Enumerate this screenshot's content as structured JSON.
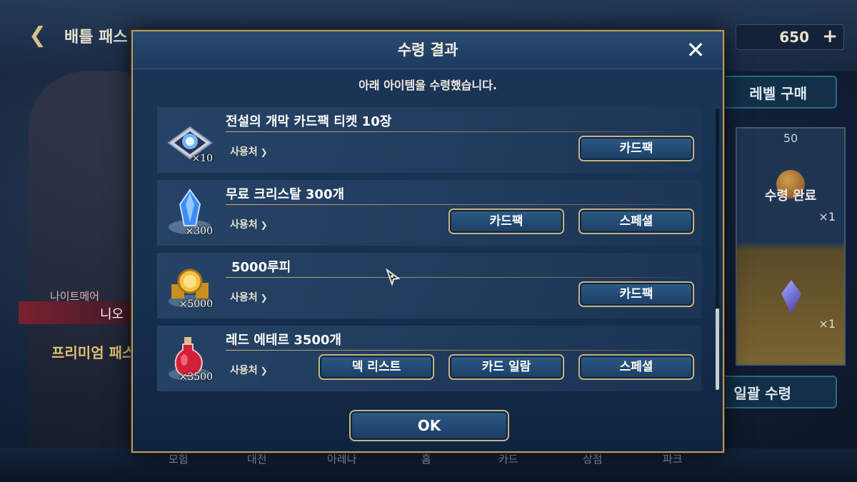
{
  "background": {
    "page_title": "배틀 패스",
    "currency_value": "650",
    "level_buy_label": "레벨 구매",
    "reward_card_level": "50",
    "reward_claimed_label": "수령 완료",
    "reward_count_1": "×1",
    "reward_count_2": "×1",
    "bulk_claim_label": "일괄 수령",
    "nightmare_label": "나이트메어",
    "nio_label": "니오",
    "premium_label": "프리미엄 패스",
    "nav": [
      "모험",
      "대전",
      "아레나",
      "홈",
      "카드",
      "상점",
      "파크"
    ]
  },
  "modal": {
    "title": "수령 결과",
    "subtitle": "아래 아이템을 수령했습니다.",
    "ok_label": "OK",
    "use_label": "사용처",
    "items": [
      {
        "name": "전설의 개막 카드팩 티켓 10장",
        "count": "×10",
        "icon": "card-ticket-icon",
        "buttons": [
          "카드팩"
        ]
      },
      {
        "name": "무료 크리스탈 300개",
        "count": "×300",
        "icon": "crystal-icon",
        "buttons": [
          "스페셜",
          "카드팩"
        ]
      },
      {
        "name": "5000루피",
        "count": "×5000",
        "icon": "gold-coins-icon",
        "buttons": [
          "카드팩"
        ]
      },
      {
        "name": "레드 에테르 3500개",
        "count": "×3500",
        "icon": "red-ether-potion-icon",
        "buttons": [
          "스페셜",
          "카드 일람",
          "덱 리스트"
        ]
      }
    ]
  },
  "colors": {
    "gold_border": "#b99a5c",
    "button_blue": "#2c5a86",
    "panel": "#1b3557"
  }
}
